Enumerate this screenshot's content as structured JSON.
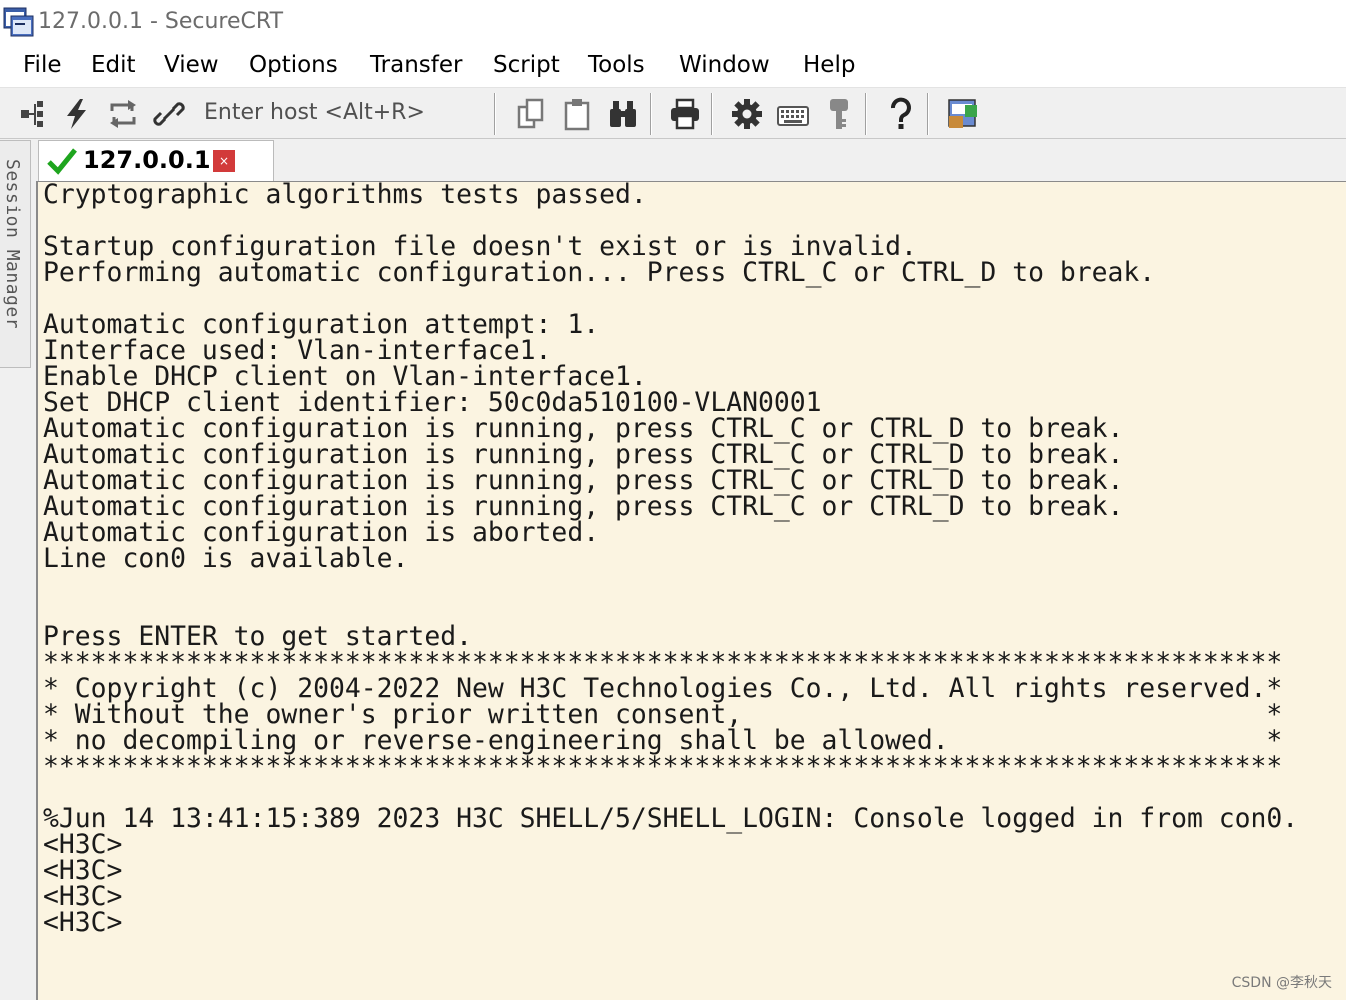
{
  "window": {
    "title": "127.0.0.1 - SecureCRT",
    "app_icon": "securecrt-app-icon"
  },
  "menu": [
    "File",
    "Edit",
    "View",
    "Options",
    "Transfer",
    "Script",
    "Tools",
    "Window",
    "Help"
  ],
  "toolbar": {
    "host_placeholder": "Enter host <Alt+R>",
    "icons": [
      "connect-tree-icon",
      "quick-connect-lightning-icon",
      "reconnect-icon",
      "disconnect-icon",
      "copy-icon",
      "paste-icon",
      "find-binoculars-icon",
      "print-icon",
      "settings-gear-icon",
      "keymap-keyboard-icon",
      "key-agent-icon",
      "help-icon",
      "sftp-icon"
    ]
  },
  "sidebar": {
    "label": "Session Manager"
  },
  "tab": {
    "label": "127.0.0.1",
    "status": "connected",
    "close_label": "×"
  },
  "terminal": {
    "lines": [
      "Cryptographic algorithms tests passed.",
      "",
      "Startup configuration file doesn't exist or is invalid.",
      "Performing automatic configuration... Press CTRL_C or CTRL_D to break.",
      "",
      "Automatic configuration attempt: 1.",
      "Interface used: Vlan-interface1.",
      "Enable DHCP client on Vlan-interface1.",
      "Set DHCP client identifier: 50c0da510100-VLAN0001",
      "Automatic configuration is running, press CTRL_C or CTRL_D to break.",
      "Automatic configuration is running, press CTRL_C or CTRL_D to break.",
      "Automatic configuration is running, press CTRL_C or CTRL_D to break.",
      "Automatic configuration is running, press CTRL_C or CTRL_D to break.",
      "Automatic configuration is aborted.",
      "Line con0 is available.",
      "",
      "",
      "Press ENTER to get started.",
      "******************************************************************************",
      "* Copyright (c) 2004-2022 New H3C Technologies Co., Ltd. All rights reserved.*",
      "* Without the owner's prior written consent,                                 *",
      "* no decompiling or reverse-engineering shall be allowed.                    *",
      "******************************************************************************",
      "",
      "%Jun 14 13:41:15:389 2023 H3C SHELL/5/SHELL_LOGIN: Console logged in from con0.",
      "<H3C>",
      "<H3C>",
      "<H3C>",
      "<H3C>"
    ]
  },
  "watermark": "CSDN @李秋天"
}
